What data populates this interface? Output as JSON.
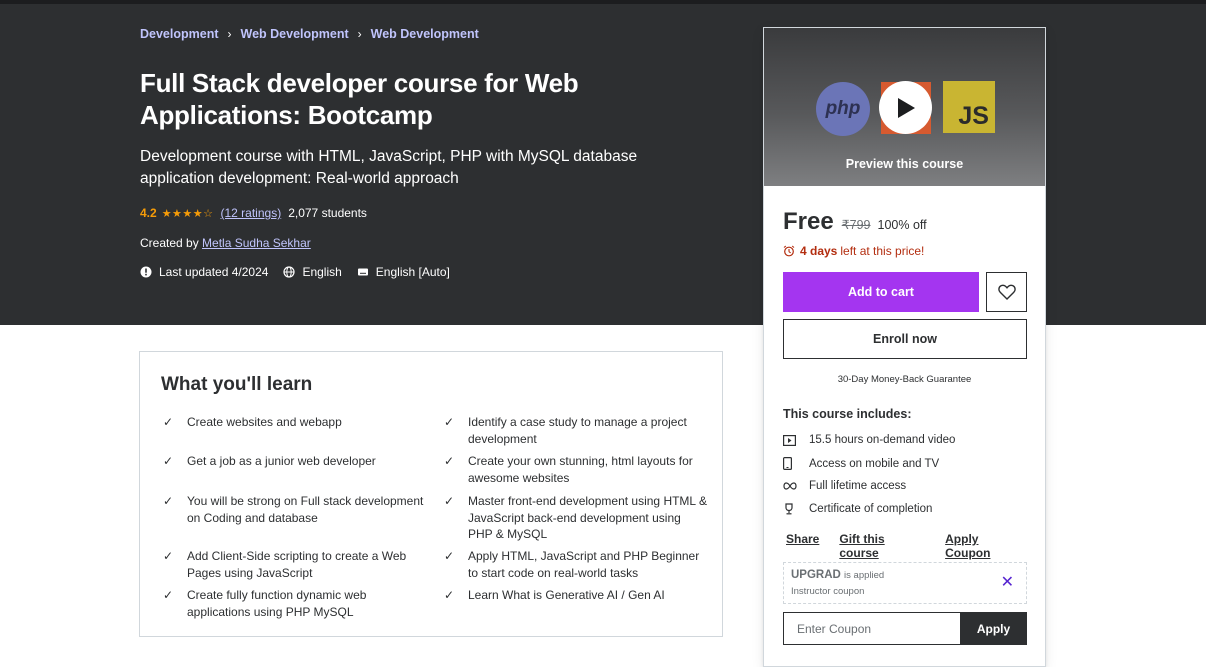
{
  "breadcrumb": [
    "Development",
    "Web Development",
    "Web Development"
  ],
  "breadcrumb_separator": "›",
  "course": {
    "title": "Full Stack developer course for Web Applications: Bootcamp",
    "subtitle": "Development course with HTML, JavaScript, PHP with MySQL database application development: Real-world approach",
    "rating": "4.2",
    "stars": "★★★★☆",
    "ratings_count": "(12 ratings)",
    "students": "2,077 students",
    "created_by_label": "Created by",
    "instructor": "Metla Sudha Sekhar",
    "last_updated": "Last updated 4/2024",
    "language": "English",
    "captions": "English [Auto]"
  },
  "learn": {
    "title": "What you'll learn",
    "check_icon": "✓",
    "left": [
      "Create websites and webapp",
      "Get a job as a junior web developer",
      "You will be strong on Full stack development on Coding and database",
      "Add Client-Side scripting to create a Web Pages using JavaScript",
      "Create fully function dynamic web applications using PHP MySQL"
    ],
    "right": [
      "Identify a case study to manage a project development",
      "Create your own stunning, html layouts for awesome websites",
      "Master front-end development using HTML & JavaScript back-end development using PHP & MySQL",
      "Apply HTML, JavaScript and PHP Beginner to start code on real-world tasks",
      "Learn What is Generative AI / Gen AI"
    ]
  },
  "sidebar": {
    "preview": {
      "label": "Preview this course",
      "php_logo": "php",
      "js_logo": "JS"
    },
    "price": "Free",
    "original_price": "₹799",
    "discount": "100% off",
    "timer_strong": "4 days",
    "timer_text": "left at this price!",
    "add_to_cart": "Add to cart",
    "enroll_now": "Enroll now",
    "guarantee": "30-Day Money-Back Guarantee",
    "includes_title": "This course includes:",
    "includes": [
      {
        "icon": "video-icon",
        "text": "15.5 hours on-demand video"
      },
      {
        "icon": "mobile-icon",
        "text": "Access on mobile and TV"
      },
      {
        "icon": "infinity-icon",
        "text": "Full lifetime access"
      },
      {
        "icon": "trophy-icon",
        "text": "Certificate of completion"
      }
    ],
    "links": [
      "Share",
      "Gift this course",
      "Apply Coupon"
    ],
    "coupon": {
      "code": "UPGRAD",
      "applied_text": "is applied",
      "type": "Instructor coupon",
      "remove_icon": "✕",
      "input_placeholder": "Enter Coupon",
      "apply_label": "Apply"
    }
  },
  "colors": {
    "hero_bg": "#2d2f31",
    "link_purple": "#c0c4fc",
    "star": "#f69c08",
    "cta_purple": "#a435f0",
    "timer_red": "#b32d0f"
  }
}
